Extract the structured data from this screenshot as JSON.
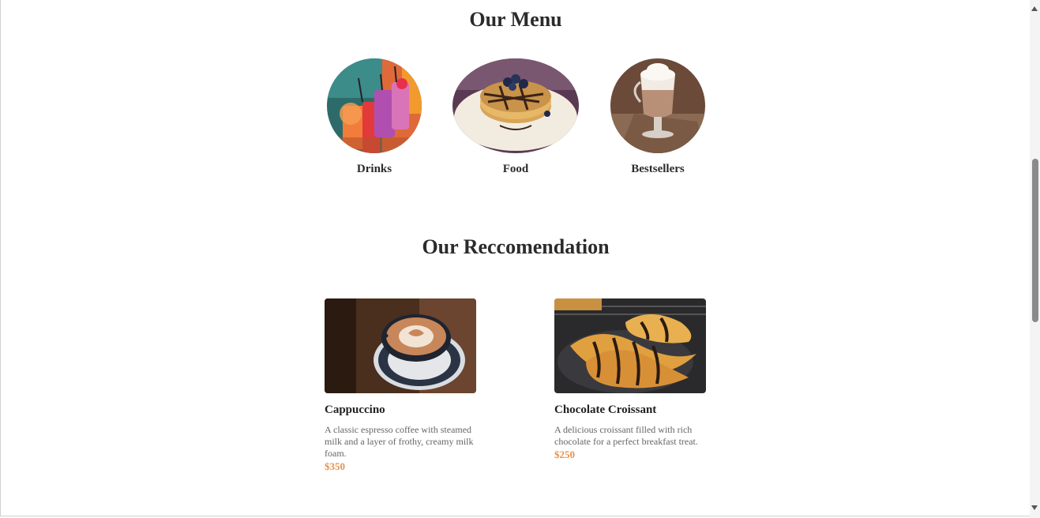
{
  "menu": {
    "title": "Our Menu",
    "categories": [
      {
        "label": "Drinks",
        "icon": "drinks-image"
      },
      {
        "label": "Food",
        "icon": "pancakes-image"
      },
      {
        "label": "Bestsellers",
        "icon": "hot-chocolate-image"
      }
    ]
  },
  "recommendation": {
    "title": "Our Reccomendation",
    "items": [
      {
        "name": "Cappuccino",
        "description": "A classic espresso coffee with steamed milk and a layer of frothy, creamy milk foam.",
        "price": "$350",
        "image": "cappuccino-image"
      },
      {
        "name": "Chocolate Croissant",
        "description": "A delicious croissant filled with rich chocolate for a perfect breakfast treat.",
        "price": "$250",
        "image": "croissant-image"
      }
    ]
  },
  "colors": {
    "price": "#e8914a",
    "heading": "#2b2b2b",
    "description": "#666666"
  }
}
